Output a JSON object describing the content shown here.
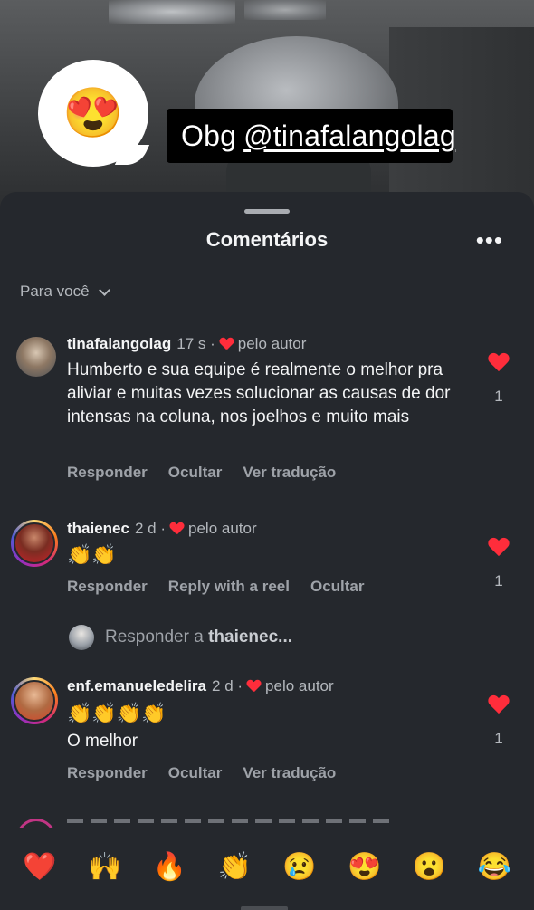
{
  "story": {
    "sticker_emoji": "😍",
    "caption_prefix": "Obg",
    "caption_mention": "@tinafalangolag"
  },
  "sheet": {
    "title": "Comentários",
    "more_label": "•••",
    "sort_label": "Para você"
  },
  "comments": [
    {
      "username": "tinafalangolag",
      "time": "17 s ·",
      "author_tag": "pelo autor",
      "text": "Humberto e sua equipe é realmente o melhor pra aliviar e muitas vezes solucionar as causas de dor intensas na coluna, nos joelhos e muito mais",
      "actions": [
        "Responder",
        "Ocultar",
        "Ver tradução"
      ],
      "likes": "1"
    },
    {
      "username": "thaienec",
      "time": "2 d ·",
      "author_tag": "pelo autor",
      "text": "👏👏",
      "actions": [
        "Responder",
        "Reply with a reel",
        "Ocultar"
      ],
      "likes": "1"
    },
    {
      "username": "enf.emanueledelira",
      "time": "2 d ·",
      "author_tag": "pelo autor",
      "text_line1": "👏👏👏👏",
      "text_line2": "O melhor",
      "actions": [
        "Responder",
        "Ocultar",
        "Ver tradução"
      ],
      "likes": "1"
    }
  ],
  "reply_prompt": {
    "prefix": "Responder a",
    "target": "thaienec..."
  },
  "reactions": [
    "❤️",
    "🙌",
    "🔥",
    "👏",
    "😢",
    "😍",
    "😮",
    "😂"
  ],
  "colors": {
    "sheet_bg": "#25282d",
    "heart": "#ff2d3b",
    "muted_text": "#9ea2a8"
  }
}
